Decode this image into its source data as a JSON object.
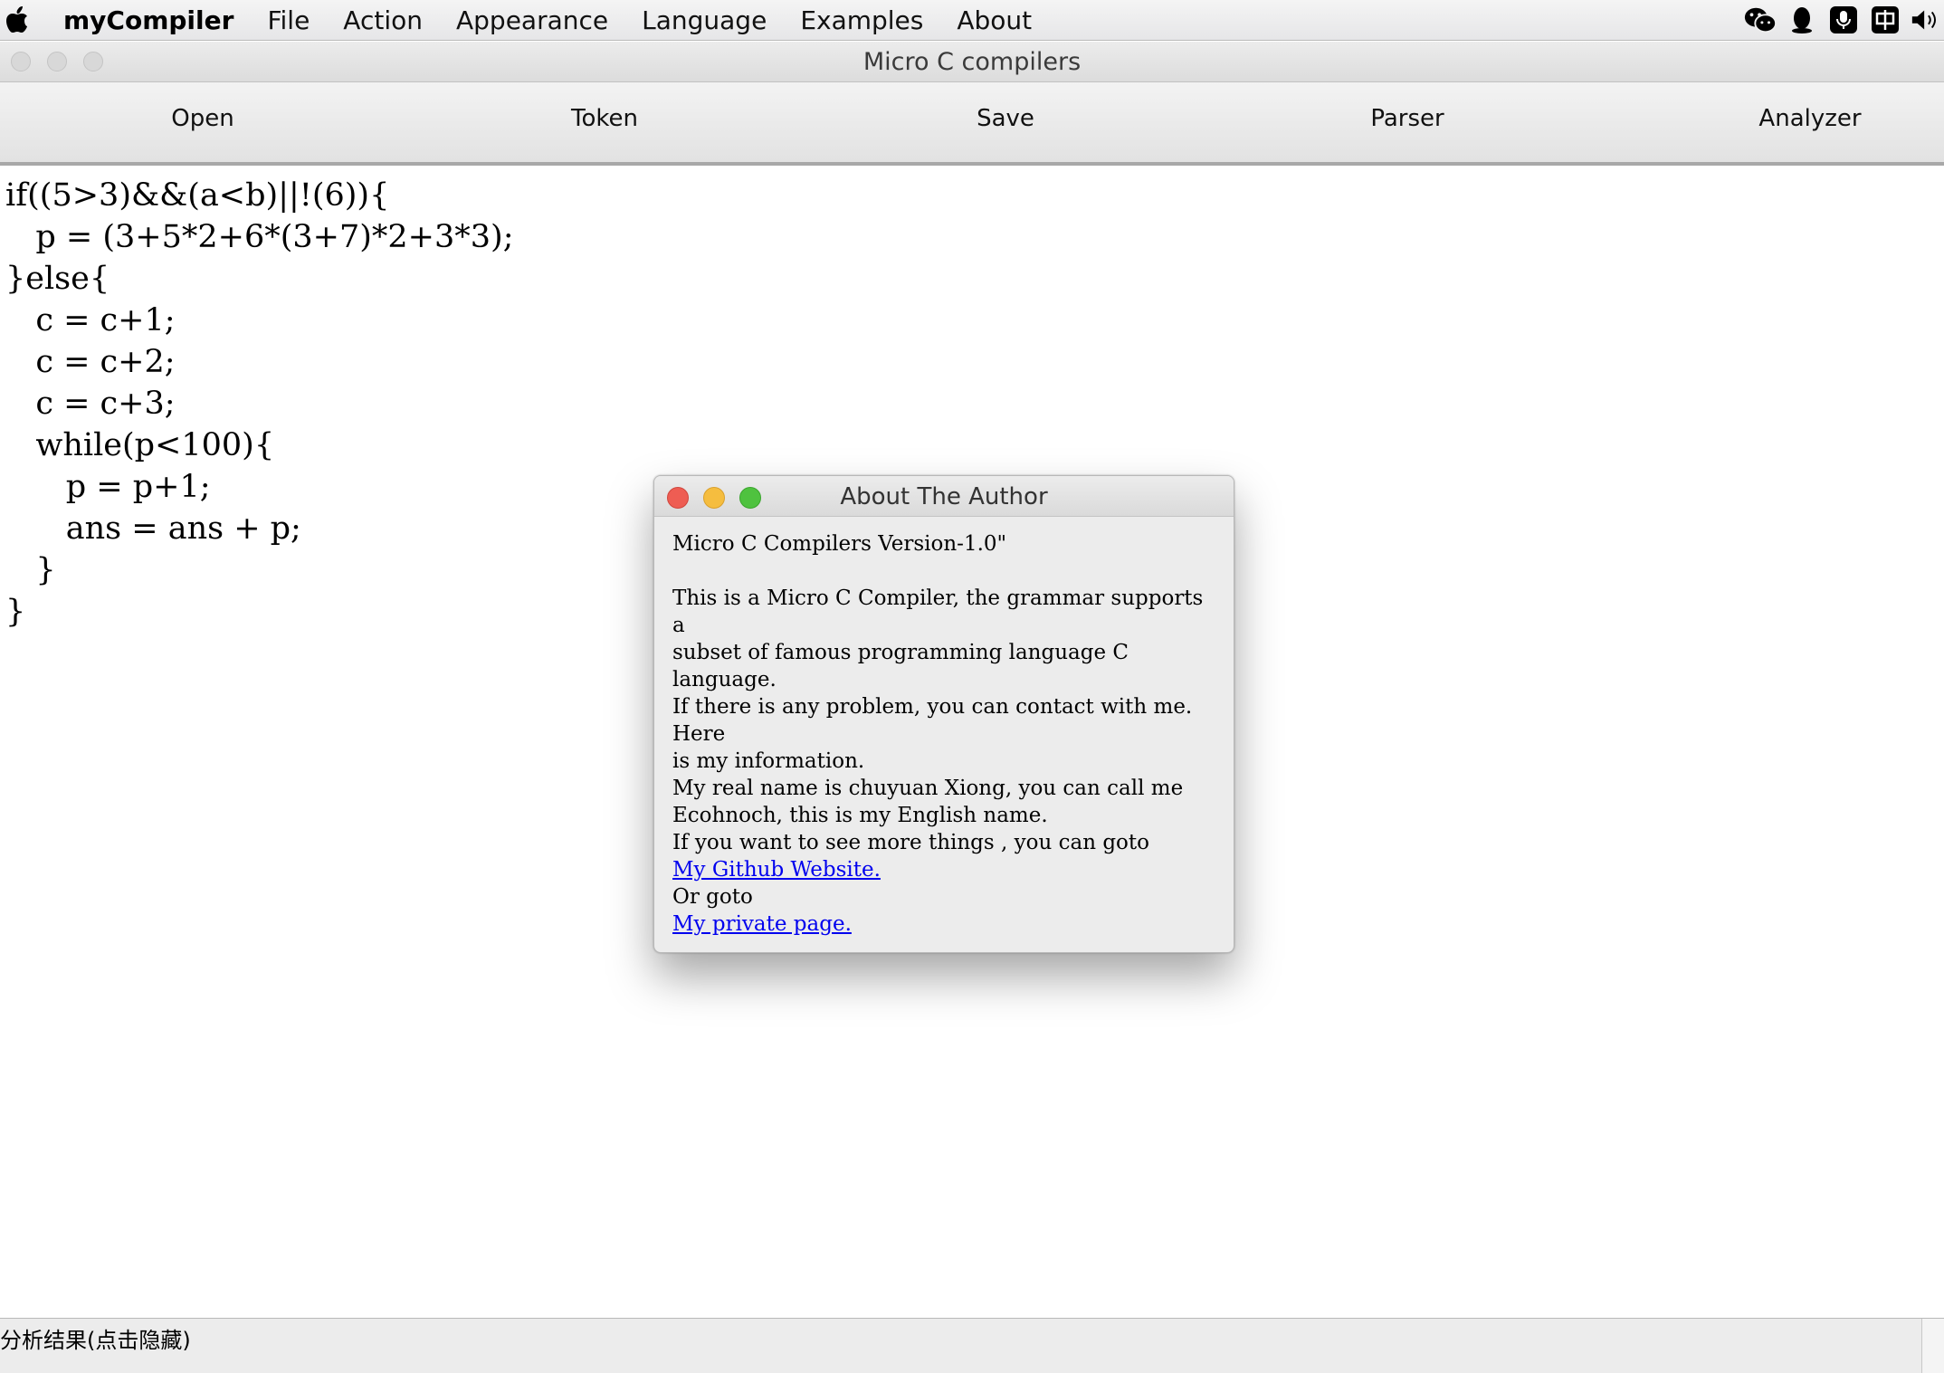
{
  "menubar": {
    "app_name": "myCompiler",
    "items": [
      "File",
      "Action",
      "Appearance",
      "Language",
      "Examples",
      "About"
    ],
    "tray_icons": [
      "wechat-icon",
      "qq-icon",
      "microphone-icon",
      "input-method-icon",
      "volume-icon"
    ]
  },
  "window": {
    "title": "Micro C compilers"
  },
  "toolbar": {
    "buttons": [
      "Open",
      "Token",
      "Save",
      "Parser",
      "Analyzer"
    ]
  },
  "editor": {
    "lines": [
      "if((5>3)&&(a<b)||!(6)){",
      "   p = (3+5*2+6*(3+7)*2+3*3);",
      "}else{",
      "   c = c+1;",
      "   c = c+2;",
      "   c = c+3;",
      "   while(p<100){",
      "      p = p+1;",
      "      ans = ans + p;",
      "   }",
      "}"
    ]
  },
  "dialog": {
    "title": "About The Author",
    "version": "Micro C Compilers Version-1.0\"",
    "paragraph_lines": [
      "This is a Micro C Compiler, the grammar supports a",
      "subset of famous programming language C language.",
      "If there is any problem, you can contact with me. Here",
      "is my information.",
      "My real name is chuyuan Xiong, you can call me",
      "Ecohnoch, this is my English name.",
      "If you want to see more things , you can goto"
    ],
    "github_link": "My Github Website.",
    "or_goto": "Or goto",
    "private_link": "My private page."
  },
  "statusbar": {
    "label": "分析结果(点击隐藏)"
  },
  "colors": {
    "close": "#ee5d53",
    "minimize": "#f5bd3f",
    "zoom": "#4fc23f",
    "link": "#0000ee"
  }
}
